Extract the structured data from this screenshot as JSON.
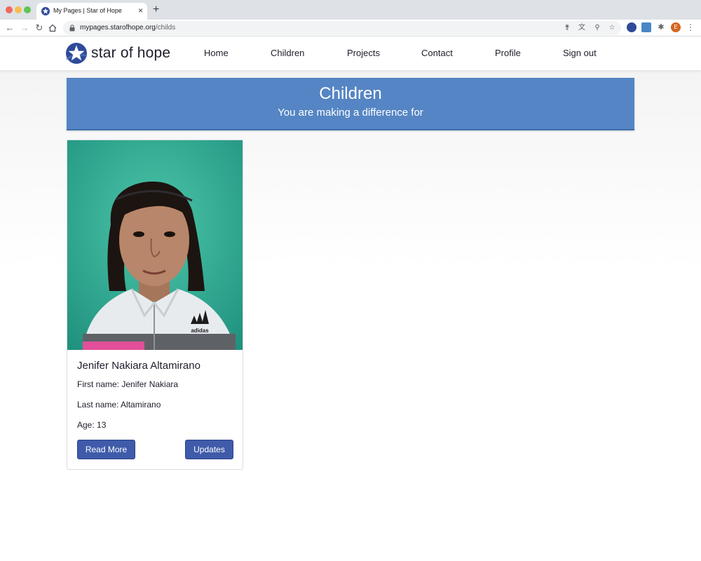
{
  "browser": {
    "tab_title": "My Pages | Star of Hope",
    "tab_close": "×",
    "new_tab": "+",
    "url_host": "mypages.starofhope.org",
    "url_path": "/childs",
    "profile_initial": "E",
    "icons": [
      "back-arrow-icon",
      "forward-arrow-icon",
      "reload-icon",
      "home-icon",
      "lock-icon",
      "key-icon",
      "translate-icon",
      "zoom-icon",
      "bookmark-star-icon",
      "extension-icon",
      "menu-icon"
    ]
  },
  "header": {
    "logo_text": "star of hope",
    "nav": [
      "Home",
      "Children",
      "Projects",
      "Contact",
      "Profile",
      "Sign out"
    ]
  },
  "banner": {
    "title": "Children",
    "subtitle": "You are making a difference for"
  },
  "child": {
    "full_name": "Jenifer Nakiara Altamirano",
    "first_name": "First name: Jenifer Nakiara",
    "last_name": "Last name: Altamirano",
    "age": "Age: 13",
    "read_more": "Read More",
    "updates": "Updates",
    "shirt_logo": "adidas"
  },
  "colors": {
    "banner": "#5585c4",
    "button": "#3f5ba9",
    "logo_blue": "#2f4a9a"
  }
}
